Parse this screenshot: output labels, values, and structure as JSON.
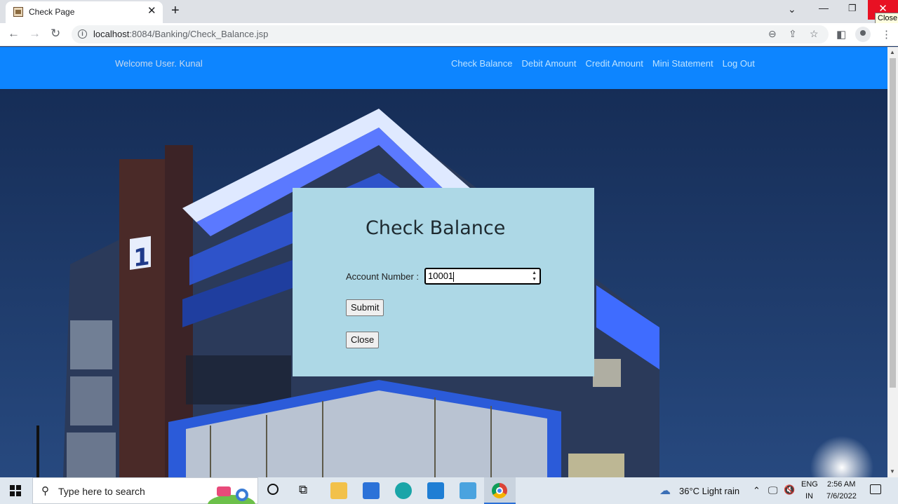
{
  "browser": {
    "tab_title": "Check Page",
    "tab_close": "✕",
    "new_tab": "+",
    "url_host": "localhost",
    "url_path": ":8084/Banking/Check_Balance.jsp",
    "tooltip": "Close",
    "close_glyph": "✕"
  },
  "navbar": {
    "welcome": "Welcome User. Kunal",
    "links": [
      "Check Balance",
      "Debit Amount",
      "Credit Amount",
      "Mini Statement",
      "Log Out"
    ]
  },
  "form": {
    "title": "Check Balance",
    "account_label": "Account Number :",
    "account_value": "10001",
    "submit_label": "Submit",
    "close_label": "Close"
  },
  "taskbar": {
    "search_placeholder": "Type here to search",
    "weather": "36°C  Light rain",
    "lang_top": "ENG",
    "lang_bottom": "IN",
    "time": "2:56 AM",
    "date": "7/6/2022"
  }
}
